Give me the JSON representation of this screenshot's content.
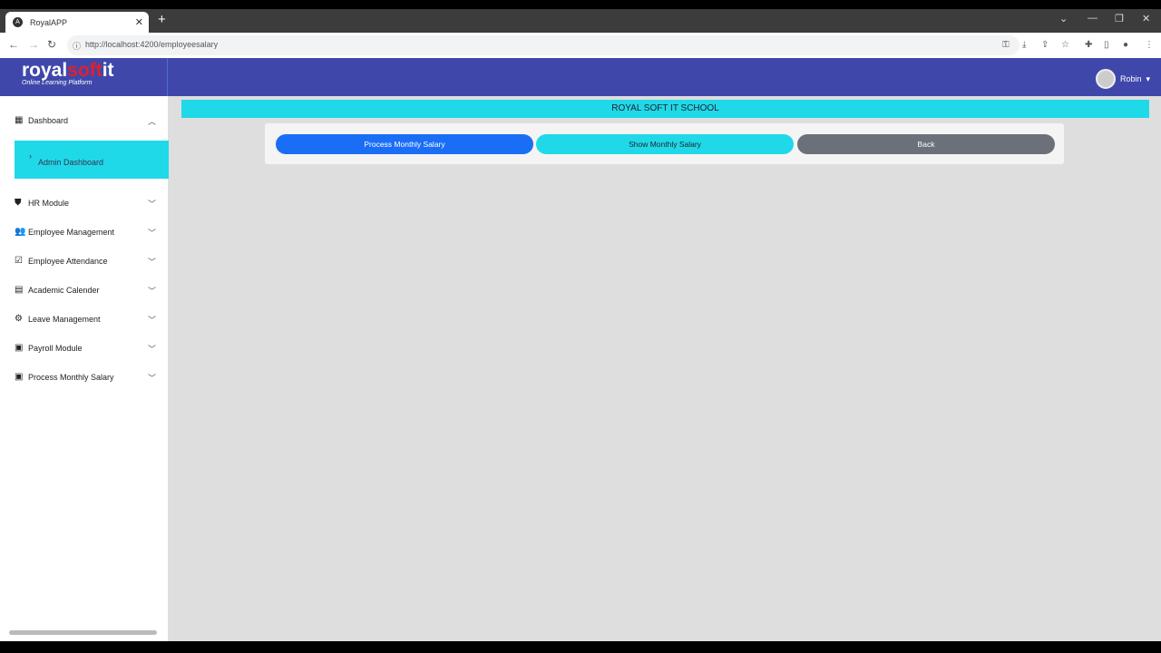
{
  "browser": {
    "tab_title": "RoyalAPP",
    "url": "http://localhost:4200/employeesalary"
  },
  "header": {
    "logo_main": "royal",
    "logo_accent": "soft",
    "logo_end": "it",
    "logo_tagline": "Online Learning Platform",
    "user_name": "Robin"
  },
  "sidebar": {
    "dashboard": "Dashboard",
    "sub_item": "Admin Dashboard",
    "items": [
      {
        "label": "HR Module",
        "icon": "shield-icon"
      },
      {
        "label": "Employee Management",
        "icon": "people-icon"
      },
      {
        "label": "Employee Attendance",
        "icon": "calendar-check-icon"
      },
      {
        "label": "Academic Calender",
        "icon": "calendar-icon"
      },
      {
        "label": "Leave Management",
        "icon": "gear-icon"
      },
      {
        "label": "Payroll Module",
        "icon": "money-icon"
      },
      {
        "label": "Process Monthly Salary",
        "icon": "money-icon"
      }
    ]
  },
  "main": {
    "banner": "ROYAL SOFT IT SCHOOL",
    "buttons": {
      "process": "Process Monthly Salary",
      "show": "Show Monthly Salary",
      "back": "Back"
    }
  },
  "colors": {
    "header": "#3f48aa",
    "accent": "#1fd9e8",
    "primary": "#1a6ef5",
    "secondary": "#6b7079"
  }
}
